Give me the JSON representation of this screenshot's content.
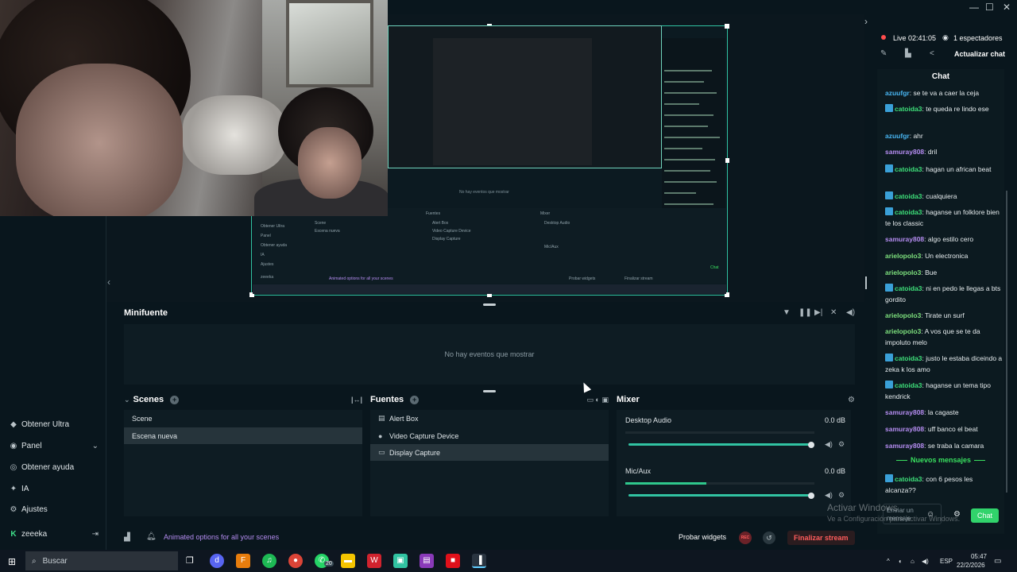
{
  "window": {
    "controls": [
      "—",
      "☐",
      "✕"
    ]
  },
  "stream_status": {
    "live_label": "Live 02:41:05",
    "viewers": "1 espectadores",
    "update_chat": "Actualizar chat"
  },
  "sidebar": {
    "items": [
      {
        "label": "Obtener Ultra",
        "icon": "ultra-icon"
      },
      {
        "label": "Panel",
        "icon": "dashboard-icon"
      },
      {
        "label": "Obtener ayuda",
        "icon": "help-icon"
      },
      {
        "label": "IA",
        "icon": "ai-icon"
      },
      {
        "label": "Ajustes",
        "icon": "settings-icon"
      }
    ],
    "user": "zeeeka"
  },
  "preview": {
    "nested_text": "No hay eventos que mostrar",
    "nested_banner": "Animated options for all your scenes",
    "nested_labels": [
      "Fuentes",
      "Mixer",
      "Desktop Audio",
      "Alert Box",
      "Video Capture Device",
      "Display Capture",
      "Scene",
      "Escena nueva",
      "Obtener Ultra",
      "Panel",
      "Obtener ayuda",
      "IA",
      "Ajustes",
      "zeeeka",
      "Probar widgets",
      "Finalizar stream",
      "Chat",
      "Mic/Aux"
    ]
  },
  "minifuente": {
    "title": "Minifuente",
    "empty": "No hay eventos que mostrar"
  },
  "scenes": {
    "title": "Scenes",
    "items": [
      "Scene",
      "Escena nueva"
    ],
    "selected": 1
  },
  "sources": {
    "title": "Fuentes",
    "items": [
      {
        "label": "Alert Box",
        "icon": "alert-box-icon"
      },
      {
        "label": "Video Capture Device",
        "icon": "camera-icon"
      },
      {
        "label": "Display Capture",
        "icon": "monitor-icon"
      }
    ],
    "selected": 2
  },
  "mixer": {
    "title": "Mixer",
    "channels": [
      {
        "label": "Desktop Audio",
        "db": "0.0 dB",
        "level": 0,
        "volume": 1.0
      },
      {
        "label": "Mic/Aux",
        "db": "0.0 dB",
        "level": 0.43,
        "volume": 1.0
      }
    ]
  },
  "footer": {
    "promo": "Animated options for all your scenes",
    "test_widgets": "Probar widgets",
    "rec": "REC",
    "end_stream": "Finalizar stream"
  },
  "chat": {
    "title": "Chat",
    "messages": [
      {
        "user": "azuufgr",
        "text": "se te va a caer la ceja",
        "color": "#48b4f0",
        "badge": false
      },
      {
        "user": "catoida3",
        "text": "te queda re lindo ese",
        "color": "#3ee07a",
        "badge": true
      },
      {
        "user": "azuufgr",
        "text": "ahr",
        "color": "#48b4f0",
        "badge": false
      },
      {
        "user": "samuray808",
        "text": "dril",
        "color": "#b48cf0",
        "badge": false
      },
      {
        "user": "catoida3",
        "text": "hagan un african beat",
        "color": "#3ee07a",
        "badge": true
      },
      {
        "user": "catoida3",
        "text": "cualquiera",
        "color": "#3ee07a",
        "badge": true
      },
      {
        "user": "catoida3",
        "text": "haganse un folklore bien te los classic",
        "color": "#3ee07a",
        "badge": true
      },
      {
        "user": "samuray808",
        "text": "algo estilo cero",
        "color": "#b48cf0",
        "badge": false
      },
      {
        "user": "arielopolo3",
        "text": "Un electronica",
        "color": "#7de07d",
        "badge": false
      },
      {
        "user": "arielopolo3",
        "text": "Bue",
        "color": "#7de07d",
        "badge": false
      },
      {
        "user": "catoida3",
        "text": "ni en pedo le llegas a bts gordito",
        "color": "#3ee07a",
        "badge": true
      },
      {
        "user": "arielopolo3",
        "text": "Tirate un surf",
        "color": "#7de07d",
        "badge": false
      },
      {
        "user": "arielopolo3",
        "text": "A vos que se te da impoluto melo",
        "color": "#7de07d",
        "badge": false
      },
      {
        "user": "catoida3",
        "text": "justo le estaba diceindo a zeka k los amo",
        "color": "#3ee07a",
        "badge": true
      },
      {
        "user": "catoida3",
        "text": "haganse un tema tipo kendrick",
        "color": "#3ee07a",
        "badge": true
      },
      {
        "user": "samuray808",
        "text": "la cagaste",
        "color": "#b48cf0",
        "badge": false
      },
      {
        "user": "samuray808",
        "text": "uff banco el beat",
        "color": "#b48cf0",
        "badge": false
      },
      {
        "user": "samuray808",
        "text": "se traba la camara",
        "color": "#b48cf0",
        "badge": false
      },
      {
        "user": "catoida3",
        "text": "con 6 pesos les alcanza??",
        "color": "#3ee07a",
        "badge": true
      }
    ],
    "new_messages": "Nuevos mensajes",
    "input_placeholder": "Enviar un mensaje",
    "send": "Chat"
  },
  "watermark": {
    "line1": "Activar Windows",
    "line2": "Ve a Configuración para activar Windows."
  },
  "taskbar": {
    "search": "Buscar",
    "notification_badge": "20",
    "lang": "ESP",
    "time": "05:47",
    "date": "22/2/2026"
  }
}
